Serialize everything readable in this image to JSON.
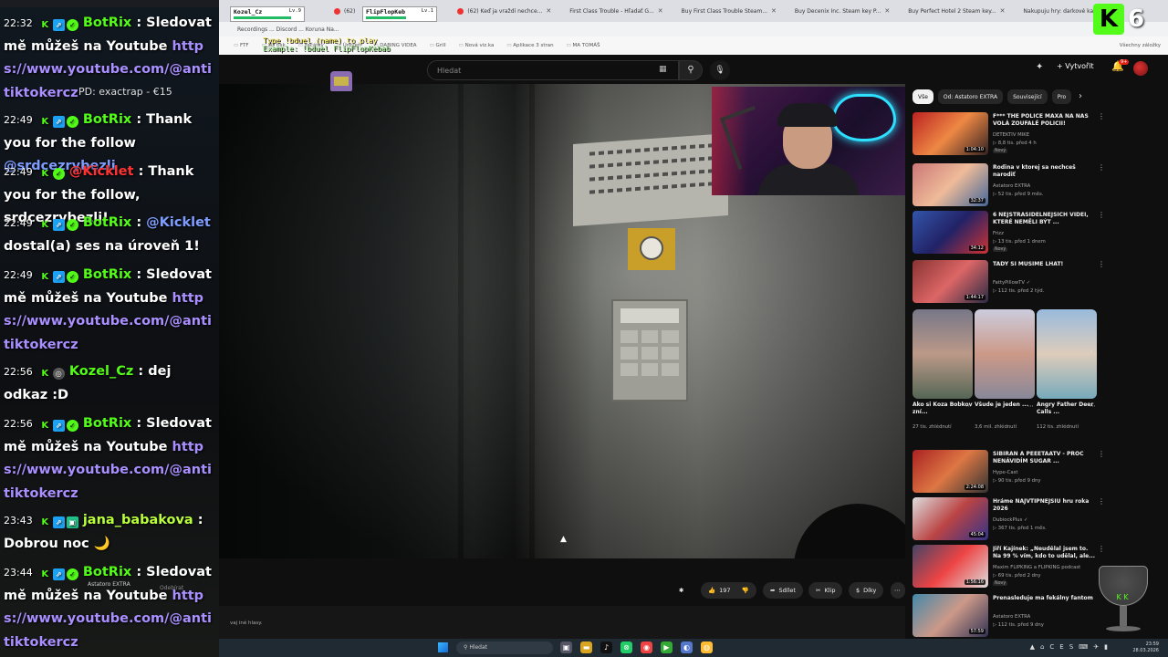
{
  "browser": {
    "tabs": [
      {
        "label": ""
      },
      {
        "label": "(62)"
      },
      {
        "label": "(62) Keď ja vraždí nechce..."
      },
      {
        "label": "First Class Trouble - Hľadať G..."
      },
      {
        "label": "Buy First Class Trouble Steam..."
      },
      {
        "label": "Buy Decenix Inc. Steam key P..."
      },
      {
        "label": "Buy Perfect Hotel 2 Steam key..."
      },
      {
        "label": "Nakupuju hry: darkové karty..."
      }
    ],
    "url_fragment": "Recordings ... Discord ... Koruna Na...",
    "bookmarks": [
      "FTF",
      "3D tisk",
      "začátky",
      "Úroveň",
      "DABING VIDEA",
      "Grill",
      "Nová viz.ka",
      "Aplikace 3 stran",
      "MA TOMÁŠ"
    ],
    "bookmarks_right": "Všechny záložky"
  },
  "youtube": {
    "search_placeholder": "Hledat",
    "create_label": "Vytvořit",
    "notif_badge": "9+",
    "actions": {
      "like_count": "197",
      "share_label": "Sdílet",
      "clip_label": "Klip",
      "thanks_label": "Díky"
    },
    "comment_hint": "vaj iné hlasy.",
    "subscribe_ghost": "Odebírat",
    "channel_ghost": "Astatoro EXTRA",
    "chips": [
      {
        "label": "Vše",
        "active": true
      },
      {
        "label": "Od: Astatoro EXTRA",
        "active": false
      },
      {
        "label": "Související",
        "active": false
      },
      {
        "label": "Pro",
        "active": false
      }
    ],
    "recommendations": [
      {
        "title": "F*** THE POLICE MAXA NA NÁS VOLÁ ZOUFALÉ POLICII!",
        "channel": "DETEKTIV MIKE",
        "meta": "▷ 8,8 tis.  před 4 h",
        "badge": "Nový",
        "duration": "1:04:10"
      },
      {
        "title": "Rodina v ktorej sa nechceš narodiť",
        "channel": "Astatoro EXTRA",
        "meta": "▷ 52 tis.  před 9 měs.",
        "badge": "",
        "duration": "32:37"
      },
      {
        "title": "6 NEJSTRAŠIDELNĚJŠÍCH VIDEÍ, KTERÉ NEMĚLI BÝT ...",
        "channel": "Frizz",
        "meta": "▷ 13 tis.  před 1 dnem",
        "badge": "Nový",
        "duration": "34:12"
      },
      {
        "title": "TADY SI MUSÍME LHÁT!",
        "channel": "FattyPillowTV ✓",
        "meta": "▷ 112 tis.  před 2 týd.",
        "badge": "",
        "duration": "1:44:17"
      }
    ],
    "shorts": [
      {
        "title": "Ako si Koza Bobkov zní...",
        "meta": "27 tis. zhlédnutí"
      },
      {
        "title": "Všude je jeden ...",
        "meta": "3,6 mil. zhlédnutí"
      },
      {
        "title": "Angry Father Deer Calls ...",
        "meta": "112 tis. zhlédnutí"
      }
    ],
    "recommendations2": [
      {
        "title": "SIBIŘAN A PEEETAATV - PROČ NENÁVIDÍM SUGAR ...",
        "channel": "Hype-Cast",
        "meta": "▷ 90 tis.  před 9 dny",
        "badge": "",
        "duration": "2:24:08"
      },
      {
        "title": "Hráme NAJVTIPNEJŠIU hru roka 2026",
        "channel": "DubiockPlus ✓",
        "meta": "▷ 367 tis.  před 1 měs.",
        "badge": "",
        "duration": "45:04"
      },
      {
        "title": "Jiří Kajínek: „Neudělal jsem to. Na 99 % vím, kdo to udělal, ale...",
        "channel": "Maxim FLIPKING a FLIPKING podcast",
        "meta": "▷ 69 tis.  před 2 dny",
        "badge": "Nový",
        "duration": "1:56:16"
      },
      {
        "title": "Prenasleduje ma fekálny fantom",
        "channel": "Astatoro EXTRA",
        "meta": "▷ 112 tis.  před 9 dny",
        "badge": "",
        "duration": "57:59"
      }
    ]
  },
  "chat": {
    "donation_text": "PD: exactrap - €15",
    "messages": [
      {
        "time": "22:32",
        "user": "BotRix",
        "text": "Sledovat mě můžeš na Youtube ",
        "link": "https://www.youtube.com/@antitiktokercz",
        "mention": ""
      },
      {
        "time": "22:49",
        "user": "BotRix",
        "text": "Thank you for the follow ",
        "link": "",
        "mention": "@srdcezrybezli"
      },
      {
        "time": "22:49",
        "user": "@Kicklet",
        "text": "Thank you for the follow, srdcezrybezli!",
        "link": "",
        "mention": ""
      },
      {
        "time": "22:49",
        "user": "BotRix",
        "text": " dostal(a) ses na úroveň 1!",
        "link": "",
        "mention": "@Kicklet"
      },
      {
        "time": "22:49",
        "user": "BotRix",
        "text": "Sledovat mě můžeš na Youtube ",
        "link": "https://www.youtube.com/@antitiktokercz",
        "mention": ""
      },
      {
        "time": "22:56",
        "user": "Kozel_Cz",
        "text": "dej odkaz :D",
        "link": "",
        "mention": ""
      },
      {
        "time": "22:56",
        "user": "BotRix",
        "text": "Sledovat mě můžeš na Youtube ",
        "link": "https://www.youtube.com/@antitiktokercz",
        "mention": ""
      },
      {
        "time": "23:43",
        "user": "jana_babakova",
        "text": "Dobrou noc 🌙",
        "link": "",
        "mention": ""
      },
      {
        "time": "23:44",
        "user": "BotRix",
        "text": "Sledovat mě můžeš na Youtube ",
        "link": "https://www.youtube.com/@antitiktokercz",
        "mention": ""
      }
    ]
  },
  "overlay": {
    "player1": {
      "name": "Kozel_Cz",
      "level": "Lv.9",
      "hp": 0.85
    },
    "player2": {
      "name": "FlipFlopKeb",
      "level": "Lv.1",
      "hp": 0.6
    },
    "command_line1": "Type !bduel (name) to play",
    "command_line2": "Example: !bduel FlipFlopKebab",
    "kick_count": "6"
  },
  "taskbar": {
    "search_placeholder": "Hledat",
    "lang": "CES",
    "time": "23:59",
    "date": "28.03.2026"
  }
}
